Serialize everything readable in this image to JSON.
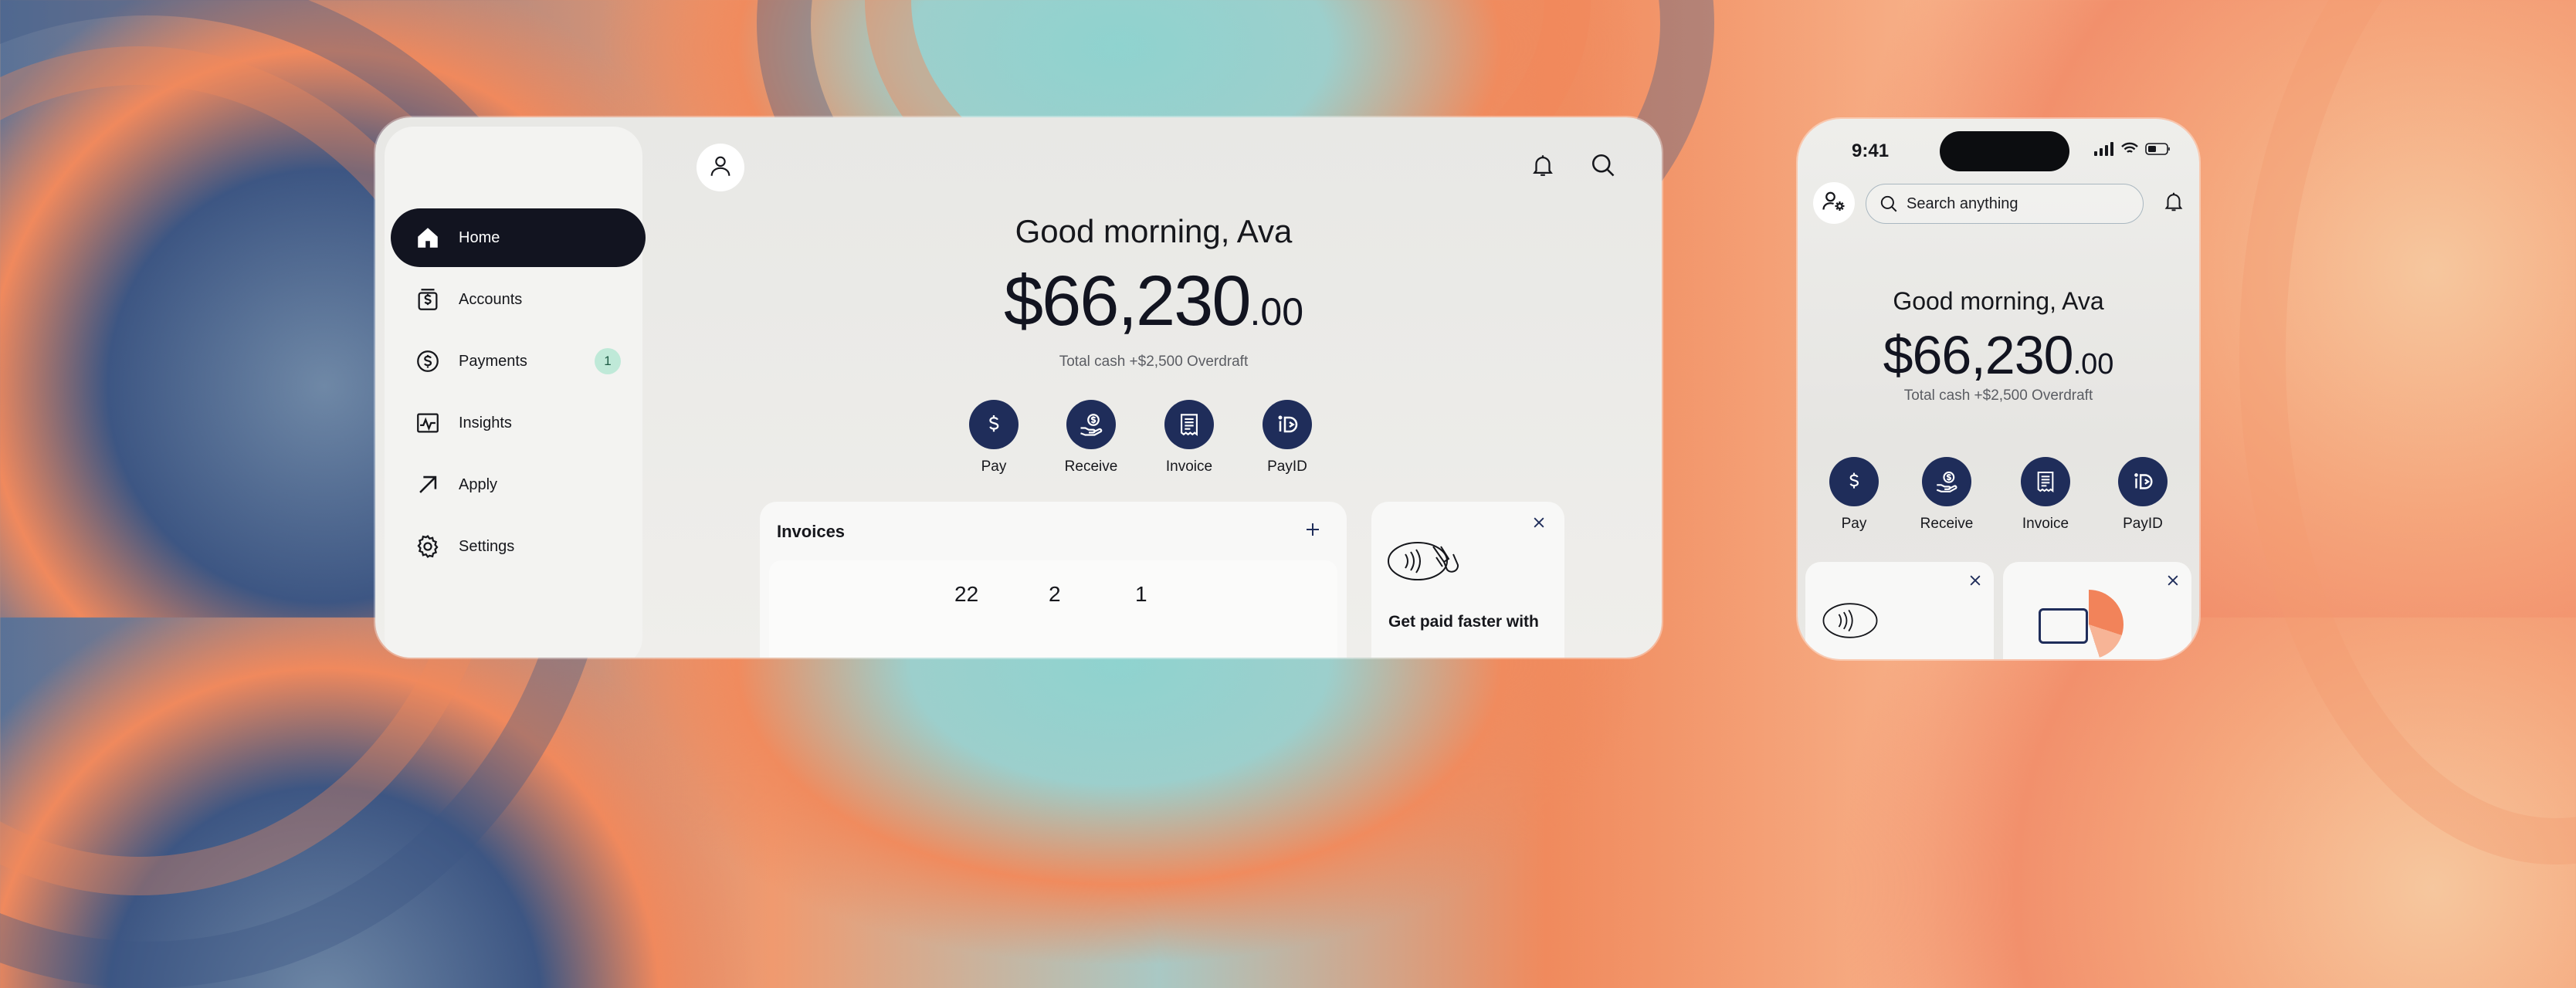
{
  "tablet": {
    "sidebar": {
      "items": [
        {
          "label": "Home",
          "icon": "home-icon",
          "active": true
        },
        {
          "label": "Accounts",
          "icon": "accounts-icon"
        },
        {
          "label": "Payments",
          "icon": "dollar-circle-icon",
          "badge": "1"
        },
        {
          "label": "Insights",
          "icon": "chart-icon"
        },
        {
          "label": "Apply",
          "icon": "arrow-up-right-icon"
        },
        {
          "label": "Settings",
          "icon": "gear-icon"
        }
      ]
    },
    "greeting": "Good morning, Ava",
    "balance_main": "$66,230",
    "balance_cents": ".00",
    "subtext": "Total cash +$2,500 Overdraft",
    "actions": [
      {
        "label": "Pay",
        "icon": "dollar-icon"
      },
      {
        "label": "Receive",
        "icon": "receive-icon"
      },
      {
        "label": "Invoice",
        "icon": "receipt-icon"
      },
      {
        "label": "PayID",
        "icon": "payid-icon"
      }
    ],
    "invoices": {
      "title": "Invoices",
      "stats": [
        "22",
        "2",
        "1"
      ]
    },
    "promo": {
      "partial_text": "Get paid faster with"
    }
  },
  "phone": {
    "time": "9:41",
    "search_placeholder": "Search anything",
    "greeting": "Good morning, Ava",
    "balance_main": "$66,230",
    "balance_cents": ".00",
    "subtext": "Total cash +$2,500 Overdraft",
    "actions": [
      {
        "label": "Pay"
      },
      {
        "label": "Receive"
      },
      {
        "label": "Invoice"
      },
      {
        "label": "PayID"
      }
    ]
  },
  "colors": {
    "accent_dark": "#121420",
    "action_navy": "#1f2d5a",
    "badge_bg": "#bfe9d8",
    "promo_orange": "#f2835a"
  }
}
